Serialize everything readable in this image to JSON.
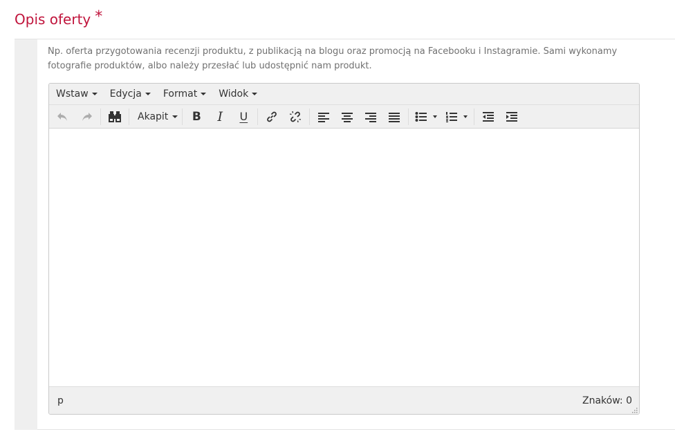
{
  "section": {
    "title": "Opis oferty",
    "required_mark": "*"
  },
  "hint": {
    "text": "Np. oferta przygotowania recenzji produktu, z publikacją na blogu oraz promocją na Facebooku i Instagramie. Sami wykonamy fotografie produktów, albo należy przesłać lub udostępnić nam produkt."
  },
  "editor": {
    "menu": [
      {
        "label": "Wstaw"
      },
      {
        "label": "Edycja"
      },
      {
        "label": "Format"
      },
      {
        "label": "Widok"
      }
    ],
    "toolbar": {
      "block_format": "Akapit",
      "bold": "B",
      "italic": "I",
      "underline": "U"
    },
    "content": "",
    "status": {
      "path": "p",
      "word_count": "Znaków: 0"
    }
  },
  "colors": {
    "accent": "#c0143c",
    "toolbar_bg": "#f0f0f0",
    "hint_text": "#707070"
  }
}
